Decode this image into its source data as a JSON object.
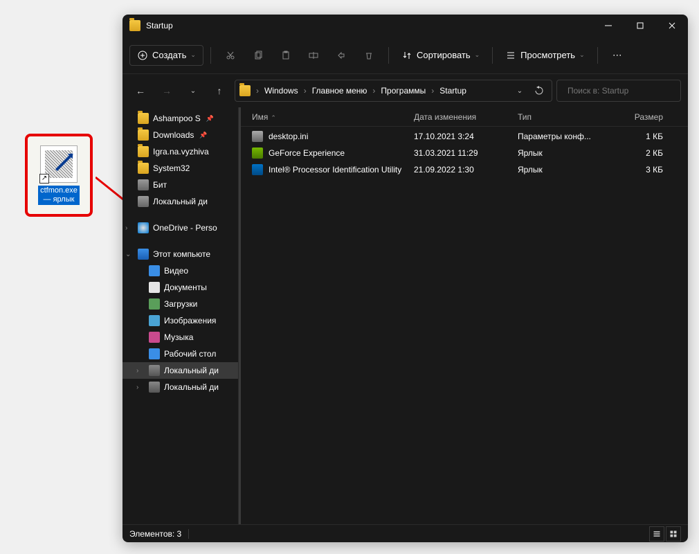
{
  "window": {
    "title": "Startup"
  },
  "toolbar": {
    "create_label": "Создать",
    "sort_label": "Сортировать",
    "view_label": "Просмотреть"
  },
  "breadcrumb": {
    "items": [
      "Windows",
      "Главное меню",
      "Программы",
      "Startup"
    ]
  },
  "search": {
    "placeholder": "Поиск в: Startup"
  },
  "sidebar": {
    "items": [
      {
        "label": "Ashampoo S",
        "icon": "ico-folder",
        "pinned": true
      },
      {
        "label": "Downloads",
        "icon": "ico-folder",
        "pinned": true
      },
      {
        "label": "Igra.na.vyzhiva",
        "icon": "ico-folder"
      },
      {
        "label": "System32",
        "icon": "ico-folder"
      },
      {
        "label": "Бит",
        "icon": "ico-drive"
      },
      {
        "label": "Локальный ди",
        "icon": "ico-drive"
      },
      {
        "label": "OneDrive - Perso",
        "icon": "ico-onedrive",
        "chev": "›"
      },
      {
        "label": "Этот компьюте",
        "icon": "ico-thispc",
        "chev": "⌄"
      },
      {
        "label": "Видео",
        "icon": "ico-video",
        "nested": true
      },
      {
        "label": "Документы",
        "icon": "ico-docs",
        "nested": true
      },
      {
        "label": "Загрузки",
        "icon": "ico-dl",
        "nested": true
      },
      {
        "label": "Изображения",
        "icon": "ico-img",
        "nested": true
      },
      {
        "label": "Музыка",
        "icon": "ico-music",
        "nested": true
      },
      {
        "label": "Рабочий стол",
        "icon": "ico-desk",
        "nested": true
      },
      {
        "label": "Локальный ди",
        "icon": "ico-localdisk",
        "nested": true,
        "active": true,
        "chev": "›"
      },
      {
        "label": "Локальный ди",
        "icon": "ico-localdisk",
        "nested": true,
        "chev": "›"
      }
    ]
  },
  "columns": {
    "name": "Имя",
    "date": "Дата изменения",
    "type": "Тип",
    "size": "Размер"
  },
  "files": [
    {
      "name": "desktop.ini",
      "date": "17.10.2021 3:24",
      "type": "Параметры конф...",
      "size": "1 КБ",
      "ico": "fico-ini"
    },
    {
      "name": "GeForce Experience",
      "date": "31.03.2021 11:29",
      "type": "Ярлык",
      "size": "2 КБ",
      "ico": "fico-gf"
    },
    {
      "name": "Intel® Processor Identification Utility",
      "date": "21.09.2022 1:30",
      "type": "Ярлык",
      "size": "3 КБ",
      "ico": "fico-intel"
    }
  ],
  "status": {
    "items_label": "Элементов: 3"
  },
  "shortcut": {
    "label_line1": "ctfmon.exe",
    "label_line2": "— ярлык"
  }
}
